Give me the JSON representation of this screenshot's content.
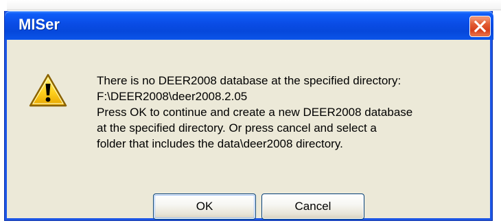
{
  "window": {
    "title": "MISer",
    "close_icon": "close-icon",
    "accent_color": "#0a4ce5",
    "close_color": "#d73f1b"
  },
  "message": {
    "icon": "warning-icon",
    "lines": [
      "There is no DEER2008 database at the specified directory:",
      "F:\\DEER2008\\deer2008.2.05",
      "Press OK to continue and create a new DEER2008 database",
      "at the specified directory. Or press cancel and select a",
      "folder that includes the data\\deer2008 directory."
    ]
  },
  "buttons": {
    "ok": "OK",
    "cancel": "Cancel"
  }
}
